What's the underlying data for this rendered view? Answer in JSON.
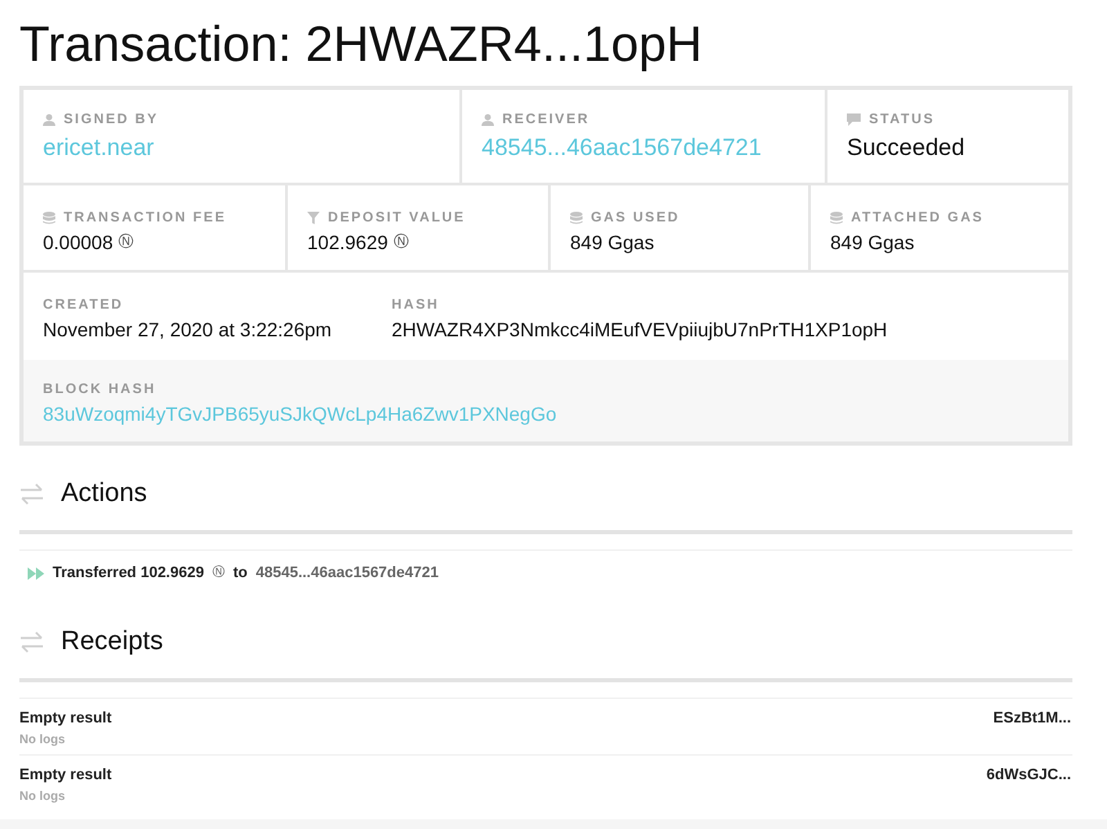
{
  "title": "Transaction: 2HWAZR4...1opH",
  "summary": [
    [
      {
        "label": "SIGNED BY",
        "value": "ericet.near",
        "kind": "link"
      },
      {
        "label": "RECEIVER",
        "value": "48545...46aac1567de4721",
        "kind": "link"
      },
      {
        "label": "STATUS",
        "value": "Succeeded",
        "kind": "text"
      }
    ],
    [
      {
        "label": "TRANSACTION FEE",
        "value": "0.00008",
        "unit": "Ⓝ",
        "kind": "text"
      },
      {
        "label": "DEPOSIT VALUE",
        "value": "102.9629",
        "unit": "Ⓝ",
        "kind": "text"
      },
      {
        "label": "GAS USED",
        "value": "849 Ggas",
        "kind": "text"
      },
      {
        "label": "ATTACHED GAS",
        "value": "849 Ggas",
        "kind": "text"
      }
    ]
  ],
  "details": [
    {
      "label": "CREATED",
      "value": "November 27, 2020 at 3:22:26pm"
    },
    {
      "label": "HASH",
      "value": "2HWAZR4XP3Nmkcc4iMEufVEVpiiujbU7nPrTH1XP1opH"
    }
  ],
  "block_hash": {
    "label": "BLOCK HASH",
    "value": "83uWzoqmi4yTGvJPB65yuSJkQWcLp4Ha6Zwv1PXNegGo"
  },
  "actions": {
    "heading": "Actions",
    "items": [
      {
        "text": "Transferred 102.9629",
        "unit": "Ⓝ",
        "to": "to",
        "receiver": "48545...46aac1567de4721"
      }
    ]
  },
  "receipts": {
    "heading": "Receipts",
    "items": [
      {
        "result": "Empty result",
        "logs": "No logs",
        "id": "ESzBt1M..."
      },
      {
        "result": "Empty result",
        "logs": "No logs",
        "id": "6dWsGJC..."
      }
    ]
  }
}
